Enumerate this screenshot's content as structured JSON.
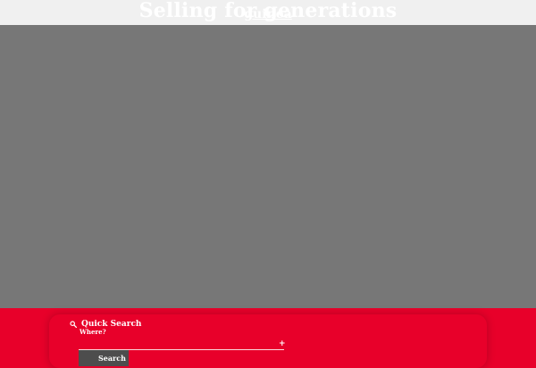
{
  "hero": {
    "title": "Selling for generations",
    "subtitle": "guinea"
  },
  "quick_search": {
    "title": "Quick Search",
    "where_label": "Where?",
    "where_placeholder": "",
    "add_icon": "+",
    "search_label": "Search"
  },
  "colors": {
    "brand_red": "#e8002a",
    "hero_bg": "#777777",
    "topbar_bg": "#f0f0f0",
    "button_bg": "#4d4d4d"
  },
  "icons": {
    "quick_search": "search-icon",
    "add": "plus-icon"
  }
}
